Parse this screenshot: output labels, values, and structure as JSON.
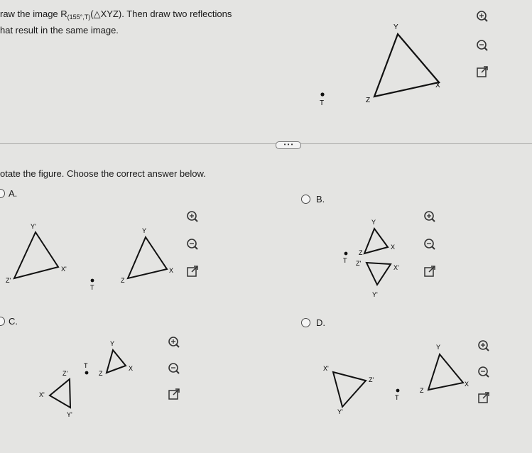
{
  "question": {
    "line1_prefix": "raw the image R",
    "line1_sub": "(155°,T)",
    "line1_suffix": "(△XYZ). Then draw two reflections",
    "line2": "hat result in the same image."
  },
  "instruction": "otate the figure. Choose the correct answer below.",
  "more_button": "• • •",
  "options": [
    {
      "letter": "A."
    },
    {
      "letter": "B."
    },
    {
      "letter": "C."
    },
    {
      "letter": "D."
    }
  ],
  "labels": {
    "X": "X",
    "Y": "Y",
    "Z": "Z",
    "T": "T",
    "Xp": "X'",
    "Yp": "Y'",
    "Zp": "Z'"
  },
  "icons": {
    "zoom_in": "zoom-in-icon",
    "zoom_out": "zoom-out-icon",
    "popout": "popout-icon"
  }
}
